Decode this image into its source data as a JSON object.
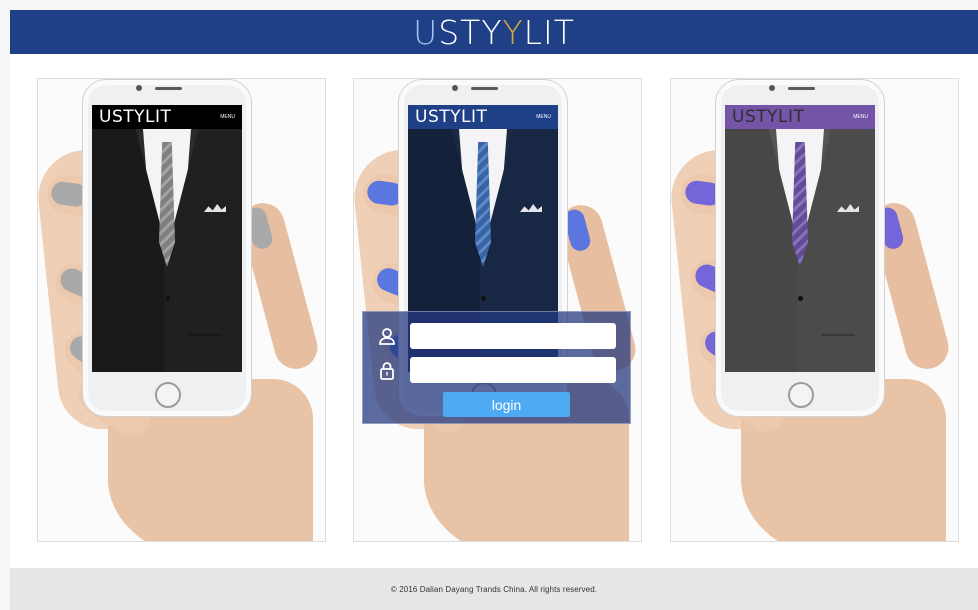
{
  "header": {
    "brand_prefix": "U",
    "brand_sty": "STY",
    "brand_y": "Y",
    "brand_lit": "LIT"
  },
  "panels": [
    {
      "theme": {
        "bar": "#000000",
        "brand": "#ffffff",
        "jacket": "#2b2b2b",
        "tie": "#8f8f8f",
        "nail": "#a9a9a9"
      },
      "mini_brand": "USTYLIT",
      "menu": "MENU"
    },
    {
      "theme": {
        "bar": "#1f3f87",
        "brand": "#ffffff",
        "jacket": "#1b2942",
        "tie": "#3c6fb8",
        "nail": "#5b76df"
      },
      "mini_brand": "USTYLIT",
      "menu": "MENU"
    },
    {
      "theme": {
        "bar": "#7454a6",
        "brand": "#2f2f2f",
        "jacket": "#555555",
        "tie": "#6d55a9",
        "nail": "#7466d8"
      },
      "mini_brand": "USTYLIT",
      "menu": "MENU"
    }
  ],
  "login": {
    "username_value": "",
    "password_value": "",
    "username_icon": "user-icon",
    "password_icon": "lock-icon",
    "button_label": "login"
  },
  "footer": {
    "copyright": "© 2016 Dalian Dayang Trands China.  All rights reserved."
  }
}
